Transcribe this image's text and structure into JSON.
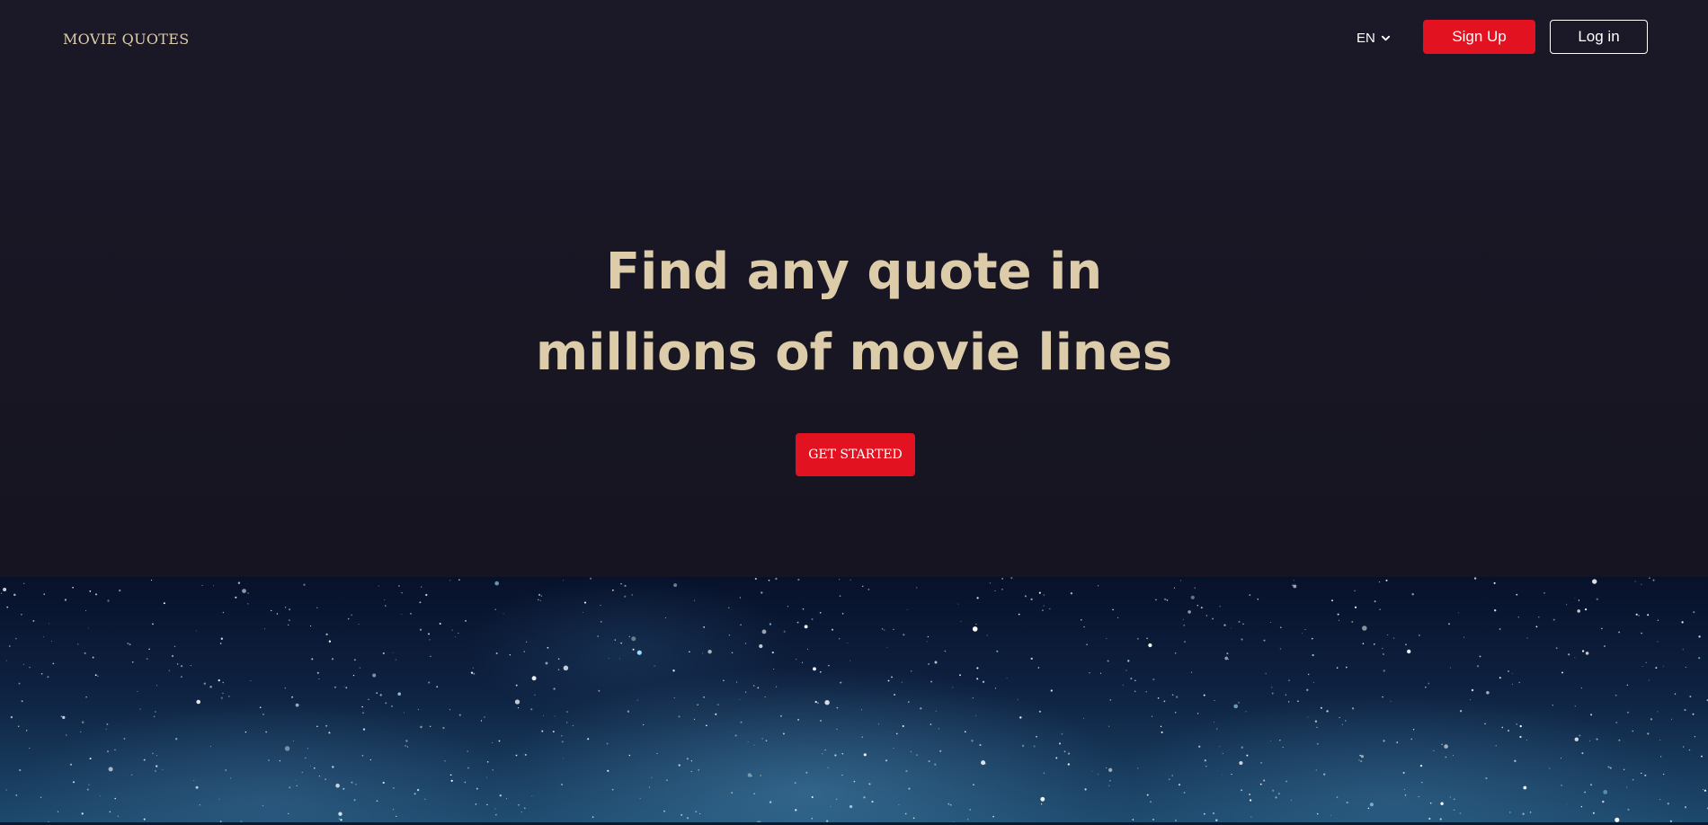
{
  "header": {
    "logo": "MOVIE QUOTES",
    "language": "EN",
    "signup_label": "Sign Up",
    "login_label": "Log in"
  },
  "hero": {
    "headline_line1": "Find any quote in",
    "headline_line2": "millions of movie lines",
    "cta_label": "GET STARTED"
  },
  "colors": {
    "accent_red": "#e31221",
    "cream": "#ddccaa",
    "background": "#181623"
  },
  "icons": {
    "language_dropdown": "chevron-down-icon"
  }
}
